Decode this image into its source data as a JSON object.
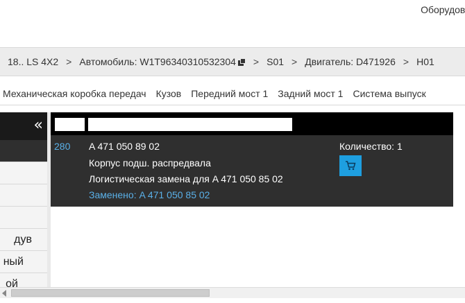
{
  "header": {
    "top_right_label": "Оборудова"
  },
  "breadcrumb": {
    "items": [
      "18.. LS 4X2",
      "Автомобиль: W1T96340310532304",
      "S01",
      "Двигатель: D471926",
      "H01"
    ],
    "separator": ">",
    "copy_icon": "copy-icon"
  },
  "category_tabs": [
    "Механическая коробка передач",
    "Кузов",
    "Передний мост 1",
    "Задний мост 1",
    "Система выпуск"
  ],
  "sidebar": {
    "collapse_glyph": "«",
    "items": [
      "",
      "",
      "",
      "",
      "дув",
      "ный",
      "ой"
    ]
  },
  "part": {
    "position": "280",
    "number": "A 471 050 89 02",
    "name": "Корпус подш. распредвала",
    "note": "Логистическая замена для A 471 050 85 02",
    "replaced_by": "Заменено: A 471 050 85 02",
    "quantity_label": "Количество: 1",
    "cart_icon": "cart-icon",
    "accent_color": "#1e9fe0"
  }
}
